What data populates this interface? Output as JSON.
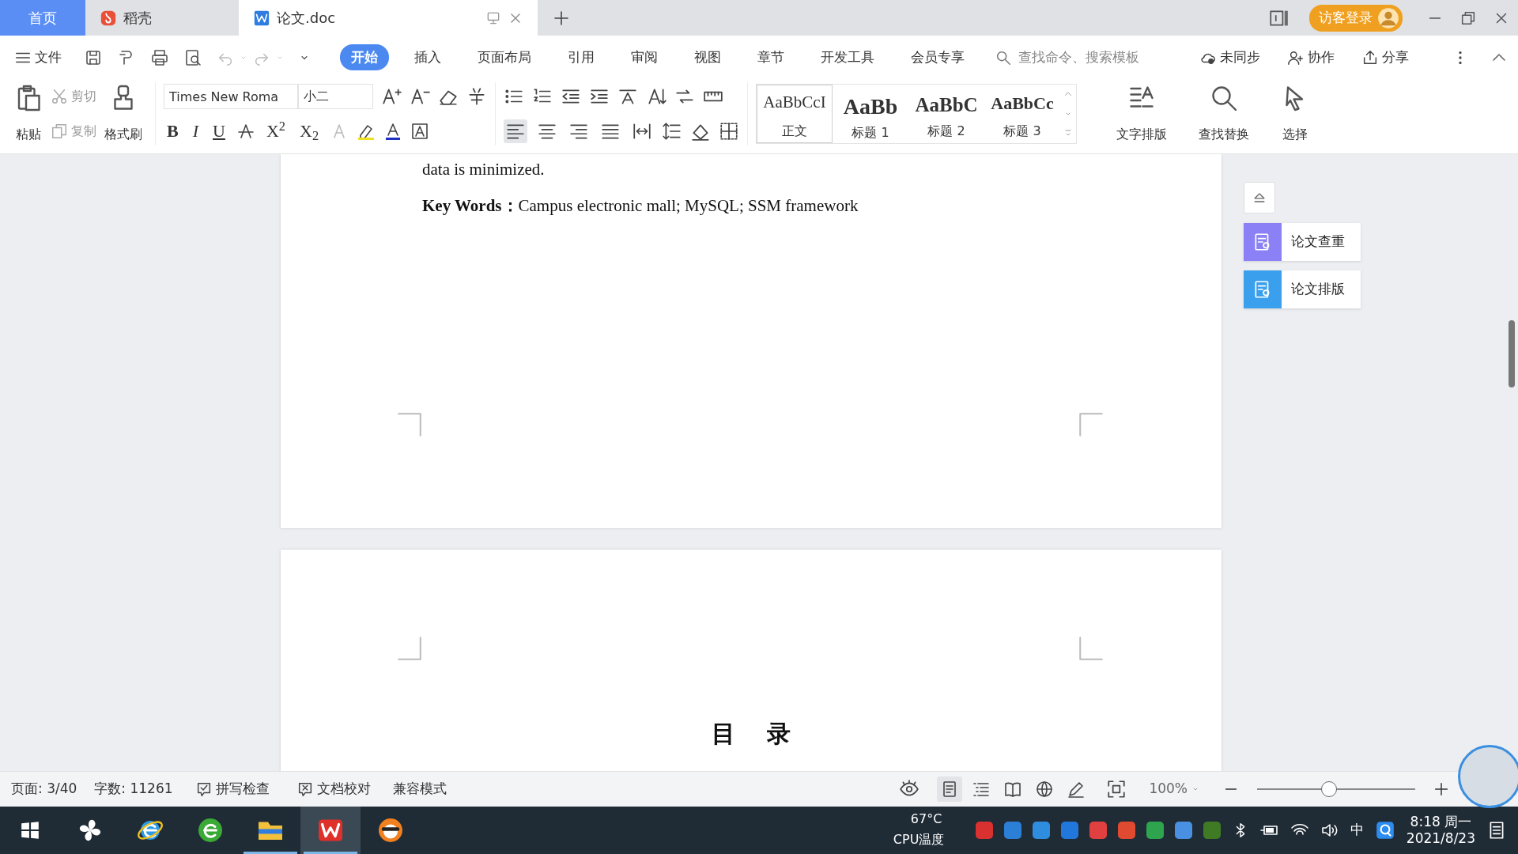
{
  "tabs": [
    {
      "label": "首页",
      "kind": "home",
      "selected": false
    },
    {
      "label": "稻壳",
      "kind": "app",
      "selected": false
    },
    {
      "label": "论文.doc",
      "kind": "doc",
      "selected": true
    }
  ],
  "title_bar": {
    "login_button": "访客登录"
  },
  "menu": {
    "file": "文件",
    "tabs": [
      {
        "label": "开始",
        "selected": true
      },
      {
        "label": "插入",
        "selected": false
      },
      {
        "label": "页面布局",
        "selected": false
      },
      {
        "label": "引用",
        "selected": false
      },
      {
        "label": "审阅",
        "selected": false
      },
      {
        "label": "视图",
        "selected": false
      },
      {
        "label": "章节",
        "selected": false
      },
      {
        "label": "开发工具",
        "selected": false
      },
      {
        "label": "会员专享",
        "selected": false
      }
    ],
    "search": {
      "placeholder": "查找命令、搜索模板"
    },
    "actions": [
      {
        "label": "未同步",
        "kind": "sync"
      },
      {
        "label": "协作",
        "kind": "collab"
      },
      {
        "label": "分享",
        "kind": "share"
      }
    ]
  },
  "ribbon": {
    "paste": "粘贴",
    "cut": "剪切",
    "copy": "复制",
    "format_painter": "格式刷",
    "font": {
      "name": "Times New Roma",
      "size": "小二"
    },
    "format_buttons": [
      "B",
      "I",
      "U",
      "X$^{2}$",
      "X$_{2}$"
    ],
    "alignment": [
      {
        "selected": true
      },
      {
        "selected": false
      },
      {
        "selected": false
      },
      {
        "selected": false
      },
      {
        "selected": false
      }
    ],
    "styles": [
      {
        "preview": "AaBbCcI",
        "label": "正文",
        "selected": true
      },
      {
        "preview": "AaBb",
        "label": "标题 1",
        "selected": false
      },
      {
        "preview": "AaBbC",
        "label": "标题 2",
        "selected": false
      },
      {
        "preview": "AaBbCc",
        "label": "标题 3",
        "selected": false
      }
    ],
    "tools": [
      {
        "label": "文字排版",
        "kind": "layout"
      },
      {
        "label": "查找替换",
        "kind": "find"
      },
      {
        "label": "选择",
        "kind": "select"
      }
    ]
  },
  "document": {
    "page_1": [
      "data is minimized.",
      "**Key Words：**Campus electronic mall; MySQL; SSM framework"
    ],
    "page_2_heading": "目 录"
  },
  "side_panel": {
    "items": [
      {
        "label": "论文查重",
        "color": "#8b80f5"
      },
      {
        "label": "论文排版",
        "color": "#3aa0ee"
      }
    ]
  },
  "status_bar": {
    "page": "页面: 3/40",
    "words": "字数: 11261",
    "spell_check": "拼写检查",
    "proofread": "文档校对",
    "mode": "兼容模式",
    "views": [
      {
        "selected": true
      },
      {
        "selected": false
      },
      {
        "selected": false
      },
      {
        "selected": false
      },
      {
        "selected": false
      }
    ],
    "zoom": "100%",
    "zoom_slider": {
      "level": 0.45
    }
  },
  "taskbar": {
    "apps": [
      {
        "kind": "fan",
        "running": false,
        "selected": false
      },
      {
        "kind": "ie",
        "running": false,
        "selected": false
      },
      {
        "kind": "browser",
        "running": false,
        "selected": false
      },
      {
        "kind": "folder",
        "running": true,
        "selected": false
      },
      {
        "kind": "wps",
        "running": true,
        "selected": true
      },
      {
        "kind": "raccoon",
        "running": false,
        "selected": false
      }
    ],
    "cpu": {
      "temperature": "67°C",
      "label": "CPU温度"
    },
    "tray": [
      {
        "color": "#d93030"
      },
      {
        "color": "#2b7fd6"
      },
      {
        "color": "#2f8de0"
      },
      {
        "color": "#2277dd"
      },
      {
        "color": "#e04040"
      },
      {
        "color": "#e04a30"
      },
      {
        "color": "#2ea44f"
      },
      {
        "color": "#4a90e2"
      },
      {
        "color": "#3f7a25"
      }
    ],
    "ime": "中",
    "time": "8:18 周一",
    "date": "2021/8/23"
  }
}
